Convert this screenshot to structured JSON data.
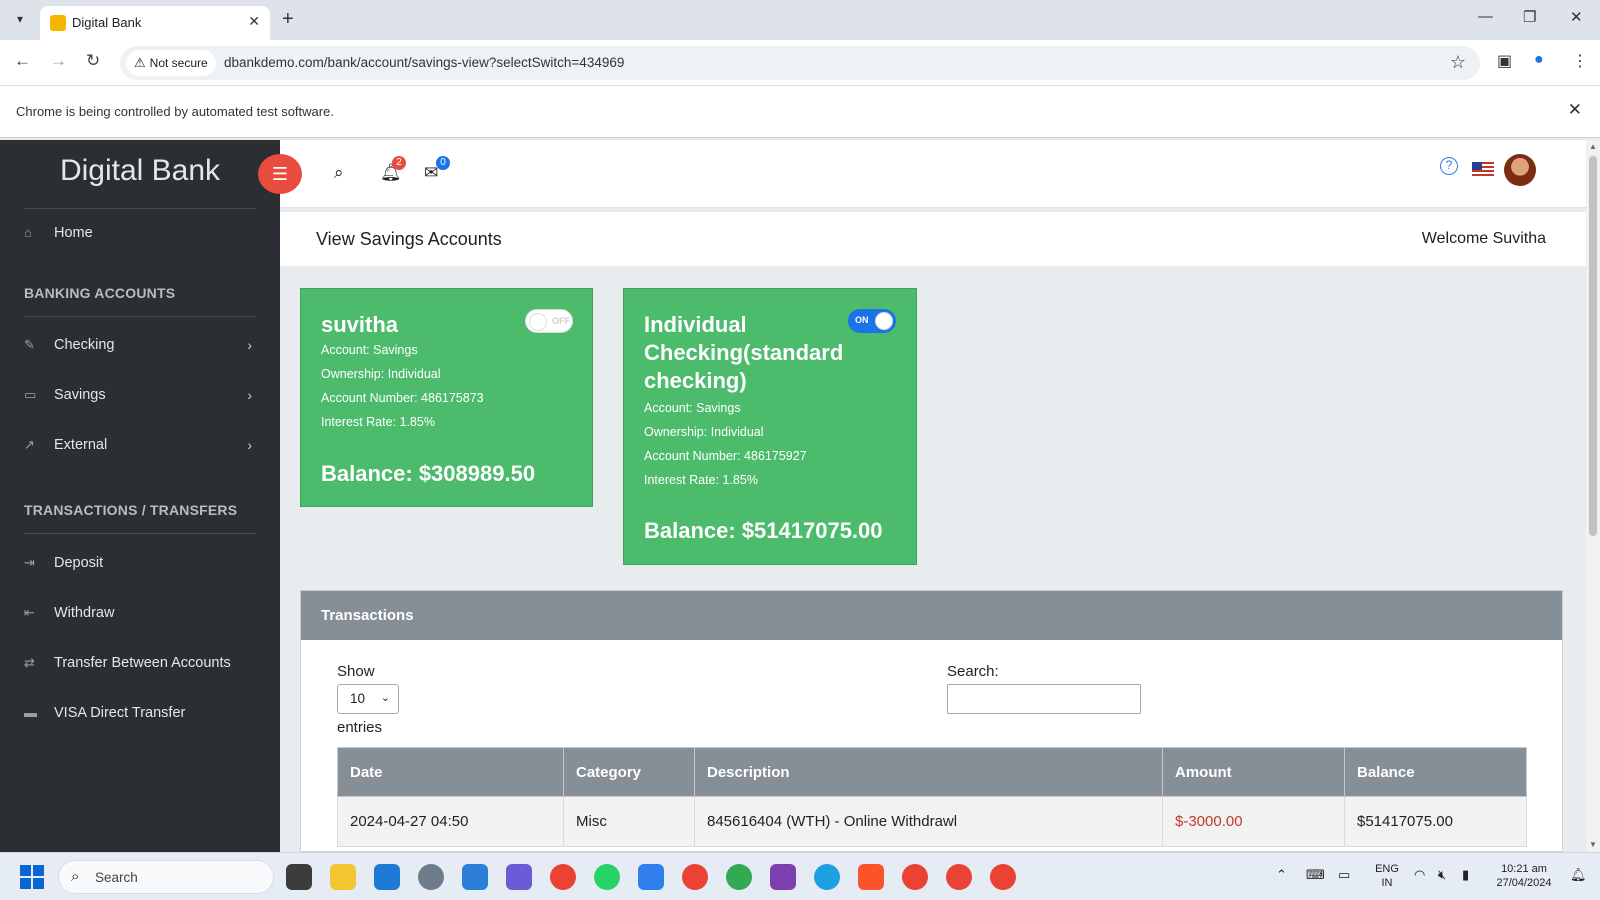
{
  "browser": {
    "tab_title": "Digital Bank",
    "security_label": "Not secure",
    "url": "dbankdemo.com/bank/account/savings-view?selectSwitch=434969",
    "infobar_text": "Chrome is being controlled by automated test software."
  },
  "app": {
    "brand_light": "Digital",
    "brand_bold": "Bank",
    "notifications_count": "2",
    "messages_count": "0",
    "page_title": "View Savings Accounts",
    "welcome": "Welcome Suvitha"
  },
  "sidebar": {
    "home": "Home",
    "section_banking": "BANKING ACCOUNTS",
    "checking": "Checking",
    "savings": "Savings",
    "external": "External",
    "section_transactions": "TRANSACTIONS / TRANSFERS",
    "deposit": "Deposit",
    "withdraw": "Withdraw",
    "transfer": "Transfer Between Accounts",
    "visa": "VISA Direct Transfer"
  },
  "accounts": [
    {
      "name": "suvitha",
      "toggle": "OFF",
      "account": "Account: Savings",
      "ownership": "Ownership: Individual",
      "number": "Account Number: 486175873",
      "rate": "Interest Rate: 1.85%",
      "balance": "Balance: $308989.50"
    },
    {
      "name": "Individual Checking(standard checking)",
      "toggle": "ON",
      "account": "Account: Savings",
      "ownership": "Ownership: Individual",
      "number": "Account Number: 486175927",
      "rate": "Interest Rate: 1.85%",
      "balance": "Balance: $51417075.00"
    }
  ],
  "transactions": {
    "title": "Transactions",
    "show_label": "Show",
    "page_size": "10",
    "entries_label": "entries",
    "search_label": "Search:",
    "columns": [
      "Date",
      "Category",
      "Description",
      "Amount",
      "Balance"
    ],
    "rows": [
      [
        "2024-04-27 04:50",
        "Misc",
        "845616404 (WTH) - Online Withdrawl",
        "$-3000.00",
        "$51417075.00"
      ]
    ]
  },
  "taskbar": {
    "search_label": "Search",
    "lang_line1": "ENG",
    "lang_line2": "IN",
    "time": "10:21 am",
    "date": "27/04/2024"
  },
  "colors": {
    "card_green": "#4cbb6c",
    "sidebar_bg": "#2b2f33",
    "menu_toggle_red": "#e74c3c",
    "negative_amount": "#c0392b"
  }
}
